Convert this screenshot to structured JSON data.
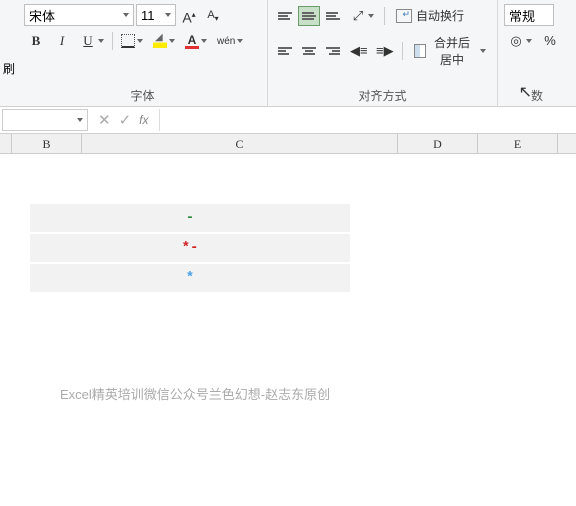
{
  "font": {
    "name": "宋体",
    "size": "11",
    "group_label": "字体",
    "B": "B",
    "I": "I",
    "U": "U",
    "A": "A",
    "wen": "wén"
  },
  "align": {
    "group_label": "对齐方式",
    "wrap": "自动换行",
    "merge": "合并后居中"
  },
  "number": {
    "format": "常规",
    "group_label": "数",
    "currency": "%"
  },
  "paste_label": "刷",
  "columns": {
    "B": "B",
    "C": "C",
    "D": "D",
    "E": "E"
  },
  "cells": {
    "r1": "-",
    "r2": "*-",
    "r3": "*"
  },
  "credit": "Excel精英培训微信公众号兰色幻想-赵志东原创",
  "fx": "fx",
  "chart_data": {
    "type": "table",
    "columns": [
      "B",
      "C",
      "D",
      "E"
    ],
    "rows": [
      {
        "C": "-"
      },
      {
        "C": "*-"
      },
      {
        "C": "*"
      }
    ]
  }
}
